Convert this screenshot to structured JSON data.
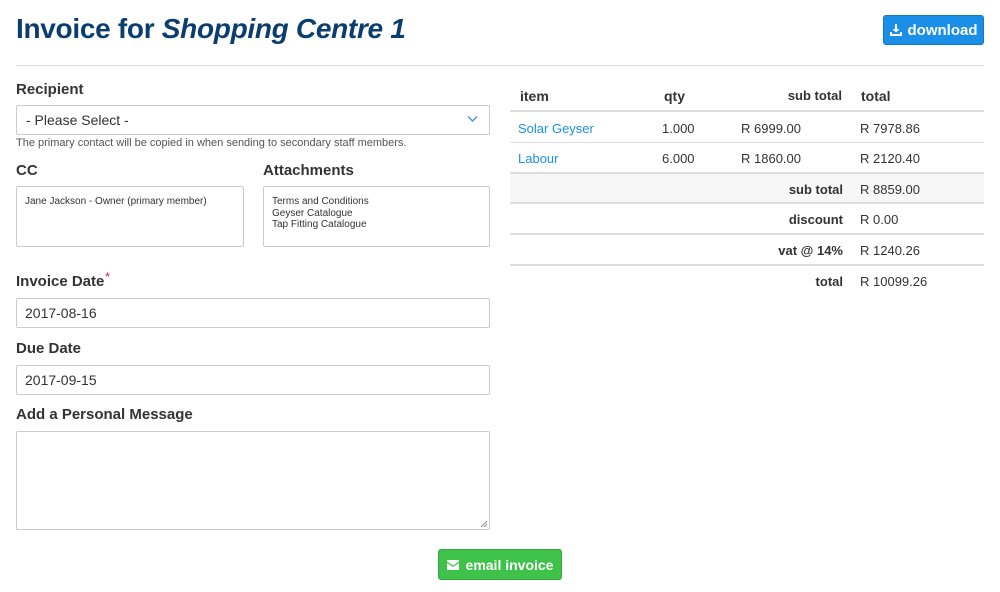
{
  "header": {
    "title_prefix": "Invoice for",
    "title_client": "Shopping Centre 1",
    "download_label": "download"
  },
  "form": {
    "recipient_label": "Recipient",
    "recipient_value": "- Please Select -",
    "recipient_help": "The primary contact will be copied in when sending to secondary staff members.",
    "cc_label": "CC",
    "cc_items": [
      "Jane Jackson - Owner (primary member)"
    ],
    "attachments_label": "Attachments",
    "attachments_items": [
      "Terms and Conditions",
      "Geyser Catalogue",
      "Tap Fitting Catalogue"
    ],
    "invoice_date_label": "Invoice Date",
    "invoice_date_required_mark": "*",
    "invoice_date_value": "2017-08-16",
    "due_date_label": "Due Date",
    "due_date_value": "2017-09-15",
    "message_label": "Add a Personal Message",
    "message_value": "",
    "email_label": "email invoice"
  },
  "table": {
    "headers": {
      "item": "item",
      "qty": "qty",
      "subtotal": "sub total",
      "total": "total"
    },
    "rows": [
      {
        "item": "Solar Geyser",
        "qty": "1.000",
        "subtotal": "R 6999.00",
        "total": "R 7978.86"
      },
      {
        "item": "Labour",
        "qty": "6.000",
        "subtotal": "R 1860.00",
        "total": "R 2120.40"
      }
    ],
    "summary": [
      {
        "label": "sub total",
        "value": "R 8859.00"
      },
      {
        "label": "discount",
        "value": "R 0.00"
      },
      {
        "label": "vat @ 14%",
        "value": "R 1240.26"
      },
      {
        "label": "total",
        "value": "R 10099.26"
      }
    ]
  },
  "colors": {
    "title": "#0b3d6e",
    "primary_button": "#1a8fe8",
    "success_button": "#3ec24a",
    "link": "#1a8fe8",
    "required": "#e8435a"
  },
  "icons": {
    "download": "download-icon",
    "email": "envelope-icon",
    "select": "chevron-down-icon"
  }
}
